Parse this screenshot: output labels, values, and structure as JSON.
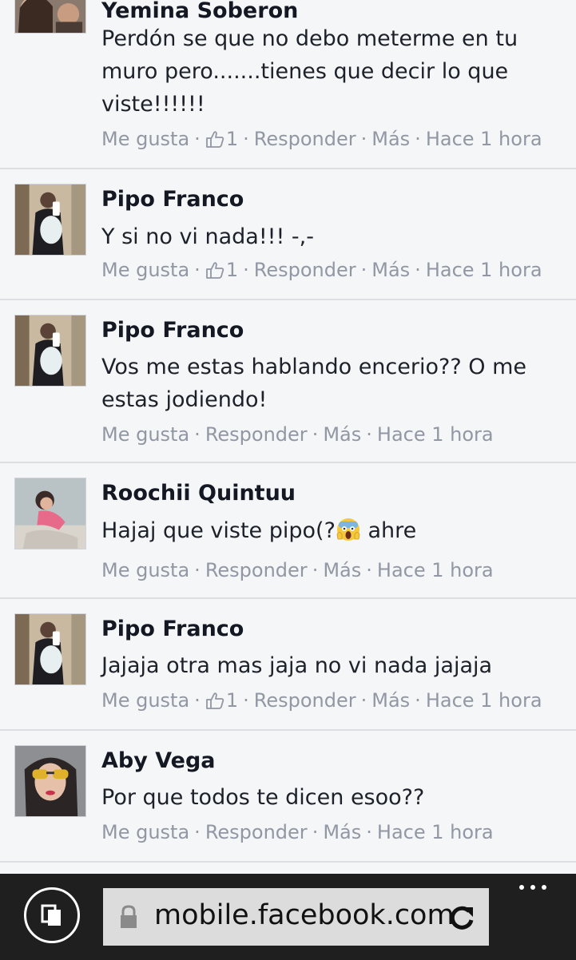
{
  "comments": [
    {
      "name": "Yemina Soberon",
      "text": "Perdón se que no debo meterme en tu muro pero.......tienes que decir lo que viste!!!!!!",
      "like": "Me gusta",
      "likes": "1",
      "reply": "Responder",
      "more": "Más",
      "time": "Hace 1 hora"
    },
    {
      "name": "Pipo Franco",
      "text": "Y si no vi nada!!! -,-",
      "like": "Me gusta",
      "likes": "1",
      "reply": "Responder",
      "more": "Más",
      "time": "Hace 1 hora"
    },
    {
      "name": "Pipo Franco",
      "text": "Vos me estas hablando encerio?? O me estas jodiendo!",
      "like": "Me gusta",
      "reply": "Responder",
      "more": "Más",
      "time": "Hace 1 hora"
    },
    {
      "name": "Roochii Quintuu",
      "text_before": "Hajaj que viste pipo(?",
      "text_after": " ahre",
      "emoji": "screaming-face-emoji",
      "like": "Me gusta",
      "reply": "Responder",
      "more": "Más",
      "time": "Hace 1 hora"
    },
    {
      "name": "Pipo Franco",
      "text": "Jajaja otra mas jaja no vi nada jajaja",
      "like": "Me gusta",
      "likes": "1",
      "reply": "Responder",
      "more": "Más",
      "time": "Hace 1 hora"
    },
    {
      "name": "Aby Vega",
      "text": "Por que todos te dicen esoo??",
      "like": "Me gusta",
      "reply": "Responder",
      "more": "Más",
      "time": "Hace 1 hora"
    }
  ],
  "browser": {
    "url": "mobile.facebook.com",
    "icons": [
      "tabs-icon",
      "lock-icon",
      "refresh-icon",
      "more-icon"
    ]
  },
  "colors": {
    "background": "#f5f6f8",
    "meta": "#9197a3",
    "name": "#141823",
    "bar": "#1f1f1f"
  }
}
